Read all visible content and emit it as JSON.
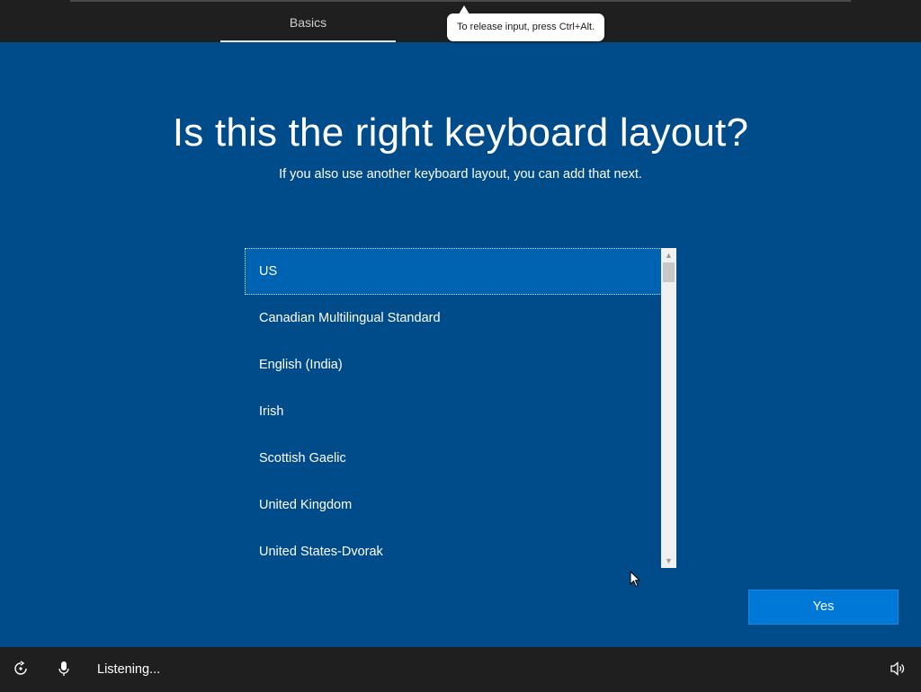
{
  "header": {
    "tab_label": "Basics"
  },
  "tooltip": {
    "text": "To release input, press Ctrl+Alt."
  },
  "main": {
    "title": "Is this the right keyboard layout?",
    "subtitle": "If you also use another keyboard layout, you can add that next.",
    "layouts": [
      {
        "label": "US",
        "selected": true
      },
      {
        "label": "Canadian Multilingual Standard",
        "selected": false
      },
      {
        "label": "English (India)",
        "selected": false
      },
      {
        "label": "Irish",
        "selected": false
      },
      {
        "label": "Scottish Gaelic",
        "selected": false
      },
      {
        "label": "United Kingdom",
        "selected": false
      },
      {
        "label": "United States-Dvorak",
        "selected": false
      }
    ],
    "yes_label": "Yes"
  },
  "footer": {
    "status_text": "Listening..."
  },
  "icons": {
    "ease_of_access": "ease-of-access-icon",
    "microphone": "microphone-icon",
    "volume": "volume-icon",
    "scroll_up": "▲",
    "scroll_down": "▼"
  },
  "colors": {
    "background_blue": "#004b8a",
    "selected_blue": "#0063b1",
    "button_blue": "#0078d7",
    "bar_dark": "#1f1f1f"
  }
}
